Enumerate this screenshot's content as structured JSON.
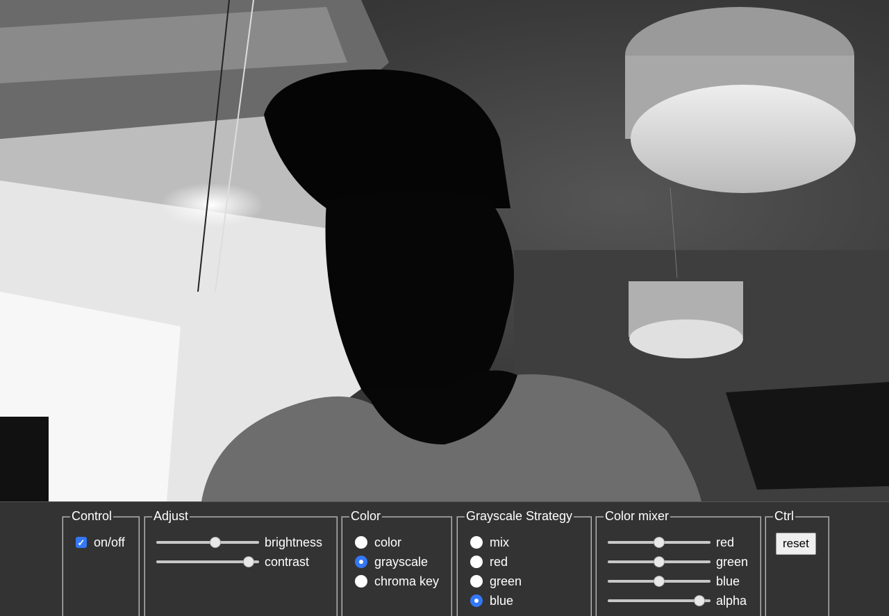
{
  "controls": {
    "control": {
      "legend": "Control",
      "toggle_label": "on/off",
      "toggle_checked": true
    },
    "adjust": {
      "legend": "Adjust",
      "sliders": [
        {
          "label": "brightness",
          "value": 0.58
        },
        {
          "label": "contrast",
          "value": 0.95
        }
      ]
    },
    "color": {
      "legend": "Color",
      "options": [
        {
          "label": "color",
          "selected": false
        },
        {
          "label": "grayscale",
          "selected": true
        },
        {
          "label": "chroma key",
          "selected": false
        }
      ]
    },
    "grayscale": {
      "legend": "Grayscale Strategy",
      "options": [
        {
          "label": "mix",
          "selected": false
        },
        {
          "label": "red",
          "selected": false
        },
        {
          "label": "green",
          "selected": false
        },
        {
          "label": "blue",
          "selected": true
        }
      ]
    },
    "mixer": {
      "legend": "Color mixer",
      "sliders": [
        {
          "label": "red",
          "value": 0.5
        },
        {
          "label": "green",
          "value": 0.5
        },
        {
          "label": "blue",
          "value": 0.5
        },
        {
          "label": "alpha",
          "value": 0.94
        }
      ]
    },
    "ctrl": {
      "legend": "Ctrl",
      "reset_label": "reset"
    }
  },
  "colors": {
    "accent": "#3478f6",
    "panel_bg": "#333333"
  }
}
